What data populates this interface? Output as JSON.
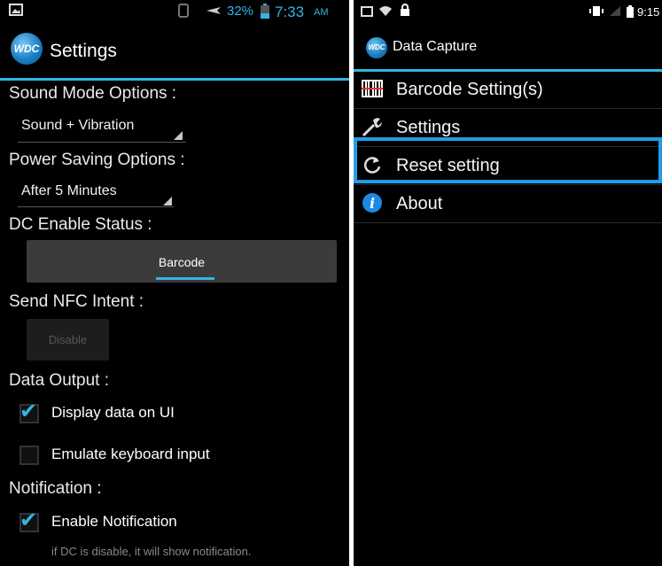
{
  "left": {
    "status": {
      "battery": "32%",
      "time": "7:33",
      "ampm": "AM"
    },
    "app_title": "Settings",
    "logo_text": "WDC",
    "sound_mode_label": "Sound Mode Options :",
    "sound_mode_value": "Sound + Vibration",
    "power_saving_label": "Power Saving Options :",
    "power_saving_value": "After 5 Minutes",
    "dc_enable_label": "DC Enable Status :",
    "dc_enable_button": "Barcode",
    "send_nfc_label": "Send NFC Intent :",
    "send_nfc_button": "Disable",
    "data_output_label": "Data Output :",
    "display_data_label": "Display data on UI",
    "display_data_checked": true,
    "emulate_keyboard_label": "Emulate keyboard input",
    "emulate_keyboard_checked": false,
    "notification_label": "Notification :",
    "enable_notification_label": "Enable Notification",
    "enable_notification_checked": true,
    "notification_hint": "if DC is disable, it will show notification."
  },
  "right": {
    "status": {
      "time": "9:15"
    },
    "app_title": "Data Capture",
    "logo_text": "WDC",
    "menu": [
      {
        "label": "Barcode Setting(s)",
        "icon": "barcode-icon"
      },
      {
        "label": "Settings",
        "icon": "wrench-icon"
      },
      {
        "label": "Reset setting",
        "icon": "reset-icon",
        "highlighted": true
      },
      {
        "label": "About",
        "icon": "info-icon"
      }
    ]
  },
  "colors": {
    "accent": "#33b5e5",
    "highlight": "#1f9ee6",
    "background": "#000000"
  }
}
